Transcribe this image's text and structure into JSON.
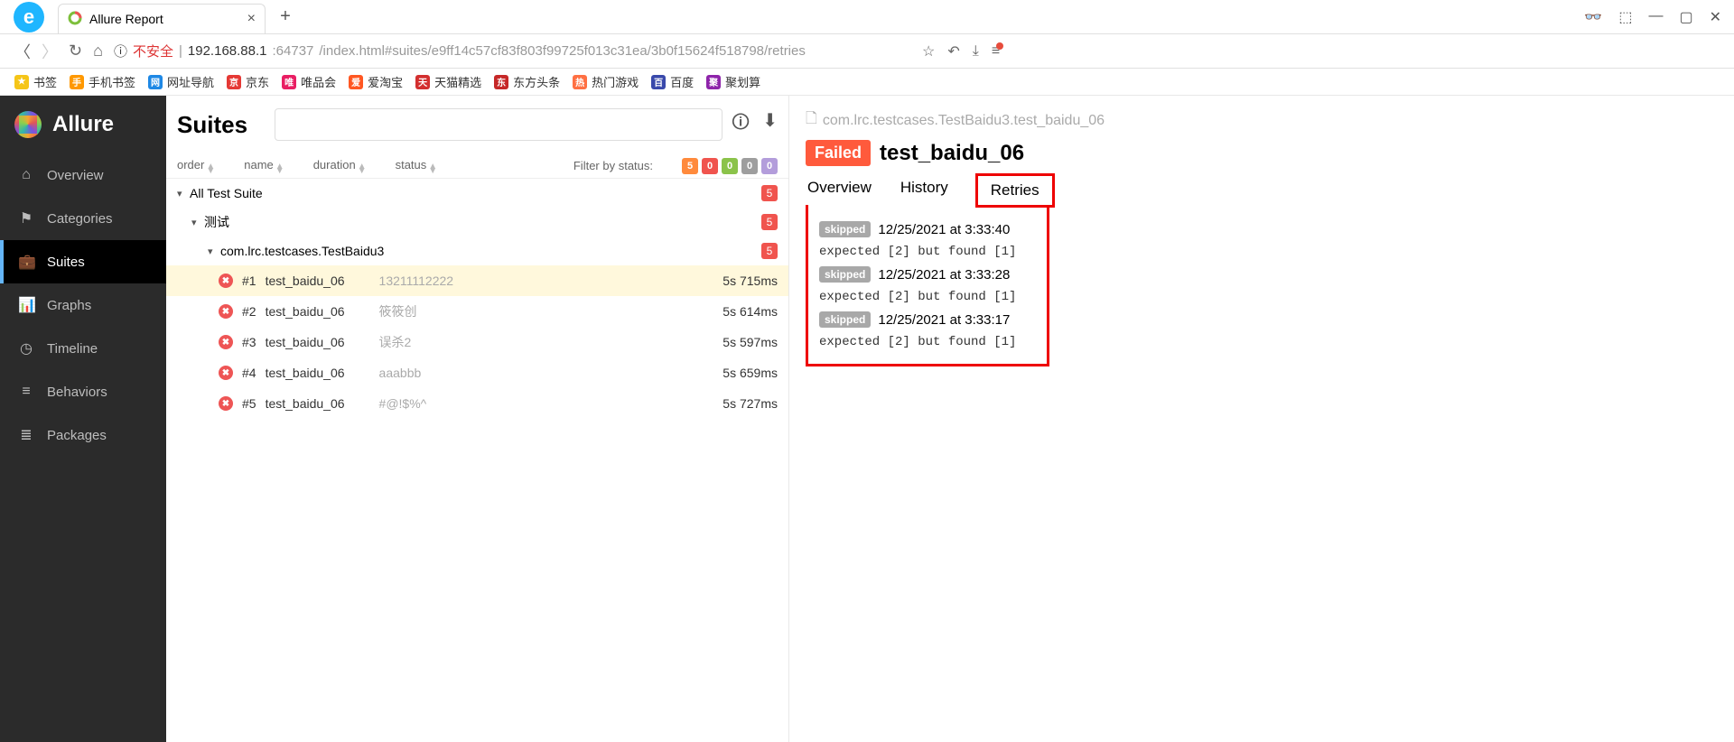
{
  "browser": {
    "tab_title": "Allure Report",
    "url_warn": "不安全",
    "url_host": "192.168.88.1",
    "url_port": ":64737",
    "url_path": "/index.html#suites/e9ff14c57cf83f803f99725f013c31ea/3b0f15624f518798/retries"
  },
  "bookmarks": [
    {
      "label": "书签",
      "color": "#f5c518"
    },
    {
      "label": "手机书签",
      "color": "#ff9800"
    },
    {
      "label": "网址导航",
      "color": "#1e88e5"
    },
    {
      "label": "京东",
      "color": "#e53935"
    },
    {
      "label": "唯品会",
      "color": "#e91e63"
    },
    {
      "label": "爱淘宝",
      "color": "#ff5722"
    },
    {
      "label": "天猫精选",
      "color": "#d32f2f"
    },
    {
      "label": "东方头条",
      "color": "#c62828"
    },
    {
      "label": "热门游戏",
      "color": "#ff7043"
    },
    {
      "label": "百度",
      "color": "#3949ab"
    },
    {
      "label": "聚划算",
      "color": "#8e24aa"
    }
  ],
  "brand": "Allure",
  "nav": [
    {
      "icon": "⌂",
      "label": "Overview"
    },
    {
      "icon": "⚑",
      "label": "Categories"
    },
    {
      "icon": "💼",
      "label": "Suites"
    },
    {
      "icon": "📊",
      "label": "Graphs"
    },
    {
      "icon": "◷",
      "label": "Timeline"
    },
    {
      "icon": "≡",
      "label": "Behaviors"
    },
    {
      "icon": "≣",
      "label": "Packages"
    }
  ],
  "nav_active": 2,
  "mid": {
    "title": "Suites",
    "cols": {
      "order": "order",
      "name": "name",
      "duration": "duration",
      "status": "status"
    },
    "filter_label": "Filter by status:",
    "filter_counts": [
      "5",
      "0",
      "0",
      "0",
      "0"
    ],
    "filter_colors": [
      "#ff8a3c",
      "#f0544e",
      "#8bc34a",
      "#9e9e9e",
      "#b39ddb"
    ]
  },
  "tree": {
    "root": {
      "label": "All Test Suite",
      "count": "5"
    },
    "suite1": {
      "label": "测试",
      "count": "5",
      "indent": 22
    },
    "suite2": {
      "label": "com.lrc.testcases.TestBaidu3",
      "count": "5",
      "indent": 40
    }
  },
  "tests": [
    {
      "num": "#1",
      "name": "test_baidu_06",
      "param": "13211112222",
      "dur": "5s 715ms",
      "selected": true
    },
    {
      "num": "#2",
      "name": "test_baidu_06",
      "param": "筱筱创",
      "dur": "5s 614ms"
    },
    {
      "num": "#3",
      "name": "test_baidu_06",
      "param": "误杀2",
      "dur": "5s 597ms"
    },
    {
      "num": "#4",
      "name": "test_baidu_06",
      "param": "aaabbb",
      "dur": "5s 659ms"
    },
    {
      "num": "#5",
      "name": "test_baidu_06",
      "param": "#@!$%^",
      "dur": "5s 727ms"
    }
  ],
  "right": {
    "crumb": "com.lrc.testcases.TestBaidu3.test_baidu_06",
    "failed": "Failed",
    "title": "test_baidu_06",
    "tabs": [
      "Overview",
      "History",
      "Retries"
    ],
    "active_tab": 2,
    "retries": [
      {
        "badge": "skipped",
        "time": "12/25/2021 at 3:33:40",
        "msg": "expected [2] but found [1]"
      },
      {
        "badge": "skipped",
        "time": "12/25/2021 at 3:33:28",
        "msg": "expected [2] but found [1]"
      },
      {
        "badge": "skipped",
        "time": "12/25/2021 at 3:33:17",
        "msg": "expected [2] but found [1]"
      }
    ]
  }
}
